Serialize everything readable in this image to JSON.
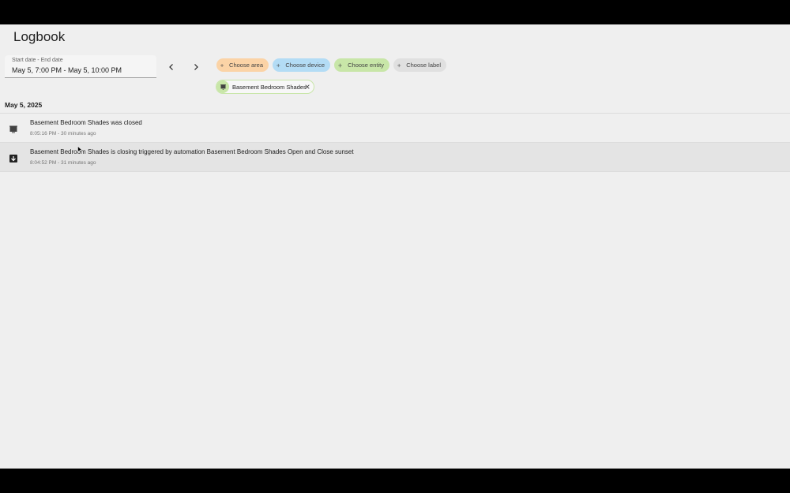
{
  "page": {
    "title": "Logbook"
  },
  "date_range": {
    "label": "Start date - End date",
    "value": "May 5, 7:00 PM - May 5, 10:00 PM"
  },
  "filters": {
    "choose_area": "Choose area",
    "choose_device": "Choose device",
    "choose_entity": "Choose entity",
    "choose_label": "Choose label",
    "selected_entity": "Basement Bedroom Shades"
  },
  "colors": {
    "area": "#fbd3a6",
    "device": "#b3dcf5",
    "entity": "#c8e6a8",
    "label": "#e0e0e0"
  },
  "log": {
    "date": "May 5, 2025",
    "entries": [
      {
        "icon": "window-shade-closed-icon",
        "message": "Basement Bedroom Shades was closed",
        "time": "8:05:16 PM - 30 minutes ago"
      },
      {
        "icon": "arrow-down-box-icon",
        "message": "Basement Bedroom Shades is closing triggered by automation Basement Bedroom Shades Open and Close sunset",
        "time": "8:04:52 PM - 31 minutes ago"
      }
    ]
  }
}
